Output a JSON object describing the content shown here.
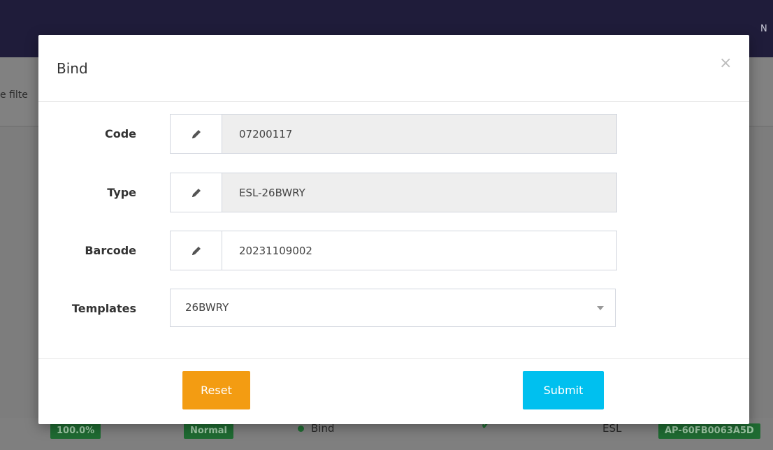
{
  "background": {
    "topbar_user": "N",
    "filter_text": "e filte",
    "row": {
      "progress_badge": "100.0%",
      "state_badge": "Normal",
      "status": "Bind",
      "type": "ESL",
      "ap_badge": "AP-60FB0063A5D"
    }
  },
  "modal": {
    "title": "Bind",
    "close_symbol": "×",
    "fields": {
      "code": {
        "label": "Code",
        "value": "07200117"
      },
      "type": {
        "label": "Type",
        "value": "ESL-26BWRY"
      },
      "barcode": {
        "label": "Barcode",
        "value": "20231109002"
      },
      "templates": {
        "label": "Templates",
        "value": "26BWRY"
      }
    },
    "buttons": {
      "reset": "Reset",
      "submit": "Submit"
    }
  },
  "colors": {
    "reset": "#f39c12",
    "submit": "#00c0ef",
    "badge_green": "#1f6b32",
    "topbar": "#1f1c3a"
  },
  "icons": [
    "pencil-icon",
    "close-icon",
    "chevron-down-icon",
    "check-icon"
  ]
}
